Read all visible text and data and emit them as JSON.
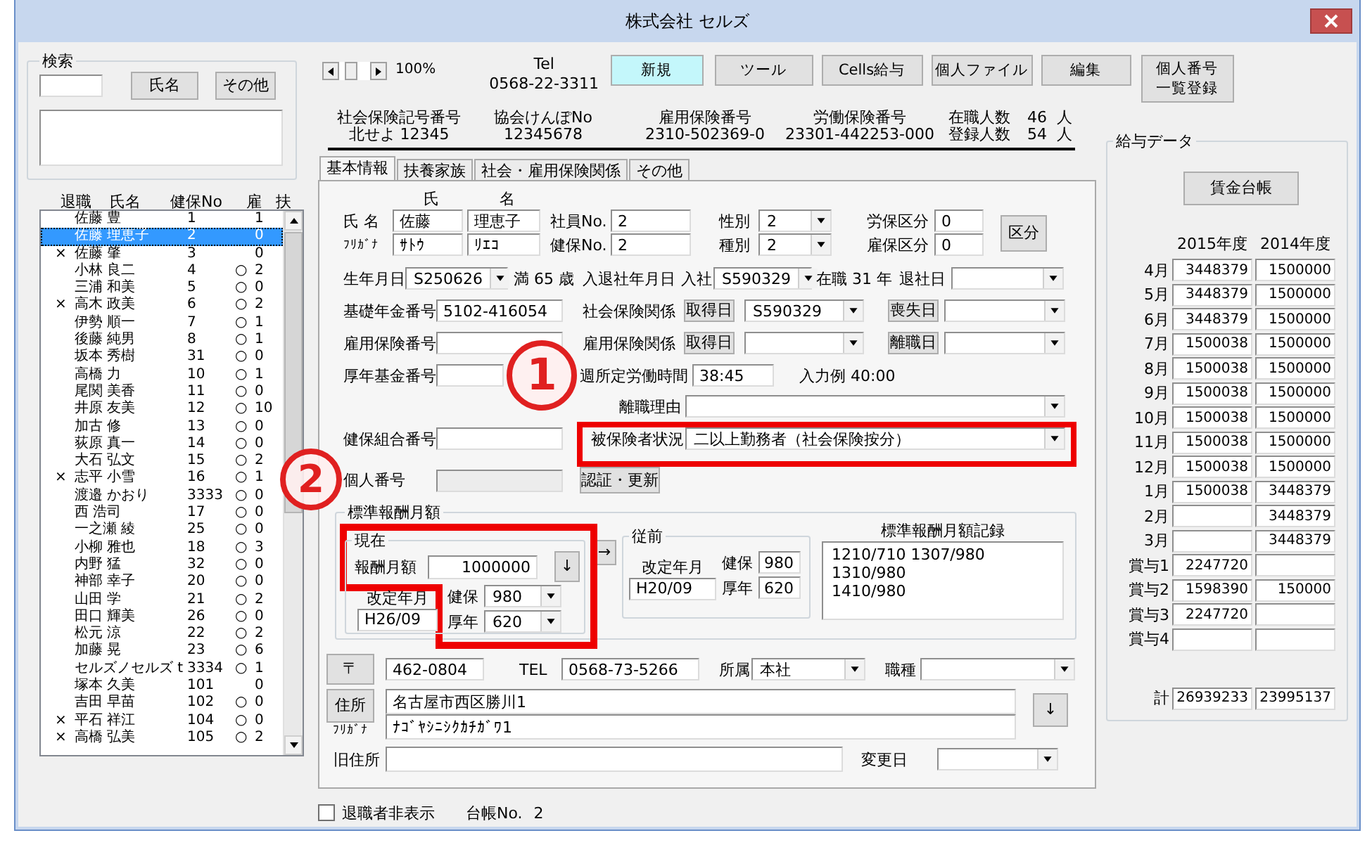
{
  "window": {
    "title": "株式会社 セルズ"
  },
  "search": {
    "title": "検索",
    "buttons": [
      "氏名",
      "その他"
    ]
  },
  "employee_list": {
    "columns": [
      "退職",
      "氏名",
      "健保No",
      "雇",
      "扶"
    ],
    "rows": [
      {
        "name": "佐藤 豊",
        "no": "1",
        "dependents": "1",
        "selected": false
      },
      {
        "name": "佐藤 理恵子",
        "no": "2",
        "dependents": "0",
        "selected": true
      },
      {
        "retired_mark": "×",
        "name": "佐藤 肇",
        "no": "3",
        "dependents": "0",
        "selected": false
      },
      {
        "name": "小林 良二",
        "no": "4",
        "insured_mark": "○",
        "dependents": "2",
        "selected": false
      },
      {
        "name": "三浦 和美",
        "no": "5",
        "insured_mark": "○",
        "dependents": "0",
        "selected": false
      },
      {
        "retired_mark": "×",
        "name": "高木 政美",
        "no": "6",
        "insured_mark": "○",
        "dependents": "2",
        "selected": false
      },
      {
        "name": "伊勢 順一",
        "no": "7",
        "insured_mark": "○",
        "dependents": "1",
        "selected": false
      },
      {
        "name": "後藤 純男",
        "no": "8",
        "insured_mark": "○",
        "dependents": "1",
        "selected": false
      },
      {
        "name": "坂本 秀樹",
        "no": "31",
        "insured_mark": "○",
        "dependents": "0",
        "selected": false
      },
      {
        "name": "高橋 力",
        "no": "10",
        "insured_mark": "○",
        "dependents": "1",
        "selected": false
      },
      {
        "name": "尾関 美香",
        "no": "11",
        "insured_mark": "○",
        "dependents": "0",
        "selected": false
      },
      {
        "name": "井原 友美",
        "no": "12",
        "insured_mark": "○",
        "dependents": "10",
        "selected": false
      },
      {
        "name": "加古 修",
        "no": "13",
        "insured_mark": "○",
        "dependents": "0",
        "selected": false
      },
      {
        "name": "荻原 真一",
        "no": "14",
        "insured_mark": "○",
        "dependents": "0",
        "selected": false
      },
      {
        "name": "大石 弘文",
        "no": "15",
        "insured_mark": "○",
        "dependents": "2",
        "selected": false
      },
      {
        "retired_mark": "×",
        "name": "志平 小雪",
        "no": "16",
        "insured_mark": "○",
        "dependents": "1",
        "selected": false
      },
      {
        "name": "渡邉 かおり",
        "no": "3333",
        "insured_mark": "○",
        "dependents": "0",
        "selected": false
      },
      {
        "name": "西 浩司",
        "no": "17",
        "insured_mark": "○",
        "dependents": "0",
        "selected": false
      },
      {
        "name": "一之瀬 綾",
        "no": "25",
        "insured_mark": "○",
        "dependents": "0",
        "selected": false
      },
      {
        "name": "小柳 雅也",
        "no": "18",
        "insured_mark": "○",
        "dependents": "3",
        "selected": false
      },
      {
        "name": "内野 猛",
        "no": "32",
        "insured_mark": "○",
        "dependents": "0",
        "selected": false
      },
      {
        "name": "神部 幸子",
        "no": "20",
        "insured_mark": "○",
        "dependents": "0",
        "selected": false
      },
      {
        "name": "山田 学",
        "no": "21",
        "insured_mark": "○",
        "dependents": "2",
        "selected": false
      },
      {
        "name": "田口 輝美",
        "no": "26",
        "insured_mark": "○",
        "dependents": "0",
        "selected": false
      },
      {
        "name": "松元 涼",
        "no": "22",
        "insured_mark": "○",
        "dependents": "2",
        "selected": false
      },
      {
        "name": "加藤 晃",
        "no": "23",
        "insured_mark": "○",
        "dependents": "6",
        "selected": false
      },
      {
        "name": "セルズノセルズ t",
        "no": "3334",
        "insured_mark": "○",
        "dependents": "1",
        "selected": false
      },
      {
        "name": "塚本 久美",
        "no": "101",
        "dependents": "0",
        "selected": false
      },
      {
        "name": "吉田 早苗",
        "no": "102",
        "insured_mark": "○",
        "dependents": "0",
        "selected": false
      },
      {
        "retired_mark": "×",
        "name": "平石 祥江",
        "no": "104",
        "insured_mark": "○",
        "dependents": "0",
        "selected": false
      },
      {
        "retired_mark": "×",
        "name": "高橋 弘美",
        "no": "105",
        "insured_mark": "○",
        "dependents": "2",
        "selected": false
      }
    ]
  },
  "toolbar": {
    "zoom": "100%",
    "tel_label": "Tel",
    "tel": "0568-22-3311",
    "buttons": [
      {
        "label": "新規",
        "highlighted": true
      },
      {
        "label": "ツール",
        "highlighted": false
      },
      {
        "label": "Cells給与",
        "highlighted": false
      },
      {
        "label": "個人ファイル",
        "highlighted": false
      },
      {
        "label": "編集",
        "highlighted": false
      },
      {
        "label": "個人番号一覧登録",
        "highlighted": false
      }
    ]
  },
  "company_info": {
    "items": [
      {
        "label": "社会保険記号番号",
        "value": "北せよ 12345"
      },
      {
        "label": "協会けんぽNo",
        "value": "12345678"
      },
      {
        "label": "雇用保険番号",
        "value": "2310-502369-0"
      },
      {
        "label": "労働保険番号",
        "value": "23301-442253-000"
      }
    ],
    "counts": [
      {
        "label": "在職人数",
        "value": "46",
        "unit": "人"
      },
      {
        "label": "登録人数",
        "value": "54",
        "unit": "人"
      }
    ]
  },
  "tabs": [
    {
      "label": "基本情報",
      "selected": true
    },
    {
      "label": "扶養家族",
      "selected": false
    },
    {
      "label": "社会・雇用保険関係",
      "selected": false
    },
    {
      "label": "その他",
      "selected": false
    }
  ],
  "basic_info": {
    "name_headers": [
      "氏",
      "名"
    ],
    "name_label": "氏 名",
    "kana_label": "ﾌﾘｶﾞﾅ",
    "name": [
      "佐藤",
      "理恵子"
    ],
    "kana": [
      "ｻﾄｳ",
      "ﾘｴｺ"
    ],
    "employee_no": {
      "label": "社員No.",
      "value": "2"
    },
    "health_no": {
      "label": "健保No.",
      "value": "2"
    },
    "gender": {
      "label": "性別",
      "value": "2"
    },
    "category": {
      "label": "種別",
      "value": "2"
    },
    "labor_ins_class": {
      "label": "労保区分",
      "value": "0"
    },
    "employment_ins_class": {
      "label": "雇保区分",
      "value": "0"
    },
    "class_button": "区分",
    "birth": {
      "label": "生年月日",
      "value": "S250626",
      "age": "満 65 歳"
    },
    "hire": {
      "label": "入退社年月日",
      "join_label": "入社",
      "join_date": "S590329",
      "tenure": "在職 31 年",
      "leave_label": "退社日"
    },
    "pension_no": {
      "label": "基礎年金番号",
      "value": "5102-416054"
    },
    "social_ins": {
      "label": "社会保険関係",
      "acquired_button": "取得日",
      "acquired": "S590329",
      "lost_button": "喪失日"
    },
    "employment_ins_no": {
      "label": "雇用保険番号"
    },
    "employment_ins": {
      "label": "雇用保険関係",
      "acquired_button": "取得日",
      "lost_button": "離職日"
    },
    "pension_fund_no": {
      "label": "厚年基金番号"
    },
    "weekly_hours": {
      "label": "週所定労働時間",
      "value": "38:45",
      "example": "入力例 40:00"
    },
    "leave_reason": {
      "label": "離職理由"
    },
    "health_union_no": {
      "label": "健保組合番号"
    },
    "insured_status": {
      "label": "被保険者状況",
      "value": "二以上勤務者（社会保険按分）"
    },
    "my_number": {
      "label": "個人番号",
      "disabled": true,
      "button": "認証・更新"
    },
    "standard_pay": {
      "title": "標準報酬月額",
      "current": {
        "title": "現在",
        "amount_label": "報酬月額",
        "amount": "1000000",
        "down_button": "↓",
        "revised_label": "改定年月",
        "revised": "H26/09",
        "health_label": "健保",
        "health": "980",
        "pension_label": "厚年",
        "pension": "620"
      },
      "copy_button": "→",
      "previous": {
        "title": "従前",
        "revised_label": "改定年月",
        "revised": "H20/09",
        "health_label": "健保",
        "health": "980",
        "pension_label": "厚年",
        "pension": "620"
      },
      "history_title": "標準報酬月額記録",
      "history": "1210/710 1307/980 1310/980\n1410/980"
    },
    "postal": {
      "button": "〒",
      "value": "462-0804"
    },
    "tel": {
      "label": "TEL",
      "value": "0568-73-5266"
    },
    "department": {
      "label": "所属",
      "value": "本社"
    },
    "job_type": {
      "label": "職種"
    },
    "address": {
      "button": "住所",
      "kana_label": "ﾌﾘｶﾞﾅ",
      "value": "名古屋市西区勝川1",
      "kana": "ﾅｺﾞﾔｼﾆｼｸｶﾁｶﾞﾜ1",
      "down_button": "↓"
    },
    "old_address": {
      "label": "旧住所",
      "change_label": "変更日"
    }
  },
  "salary_data": {
    "title": "給与データ",
    "button": "賃金台帳",
    "columns": [
      "2015年度",
      "2014年度"
    ],
    "rows": [
      {
        "label": "4月",
        "first": "3448379",
        "second": "1500000"
      },
      {
        "label": "5月",
        "first": "3448379",
        "second": "1500000"
      },
      {
        "label": "6月",
        "first": "3448379",
        "second": "1500000"
      },
      {
        "label": "7月",
        "first": "1500038",
        "second": "1500000"
      },
      {
        "label": "8月",
        "first": "1500038",
        "second": "1500000"
      },
      {
        "label": "9月",
        "first": "1500038",
        "second": "1500000"
      },
      {
        "label": "10月",
        "first": "1500038",
        "second": "1500000"
      },
      {
        "label": "11月",
        "first": "1500038",
        "second": "1500000"
      },
      {
        "label": "12月",
        "first": "1500038",
        "second": "1500000"
      },
      {
        "label": "1月",
        "first": "1500038",
        "second": "3448379"
      },
      {
        "label": "2月",
        "second": "3448379"
      },
      {
        "label": "3月",
        "second": "3448379"
      },
      {
        "label": "賞与1",
        "first": "2247720"
      },
      {
        "label": "賞与2",
        "first": "1598390",
        "second": "150000"
      },
      {
        "label": "賞与3",
        "first": "2247720"
      },
      {
        "label": "賞与4"
      }
    ],
    "total": {
      "label": "計",
      "first": "26939233",
      "second": "23995137"
    }
  },
  "footer": {
    "checkbox": {
      "label": "退職者非表示",
      "checked": false
    },
    "ledger_label": "台帳No.",
    "ledger_no": "2"
  },
  "annotations": [
    {
      "label": "1"
    },
    {
      "label": "2"
    }
  ]
}
